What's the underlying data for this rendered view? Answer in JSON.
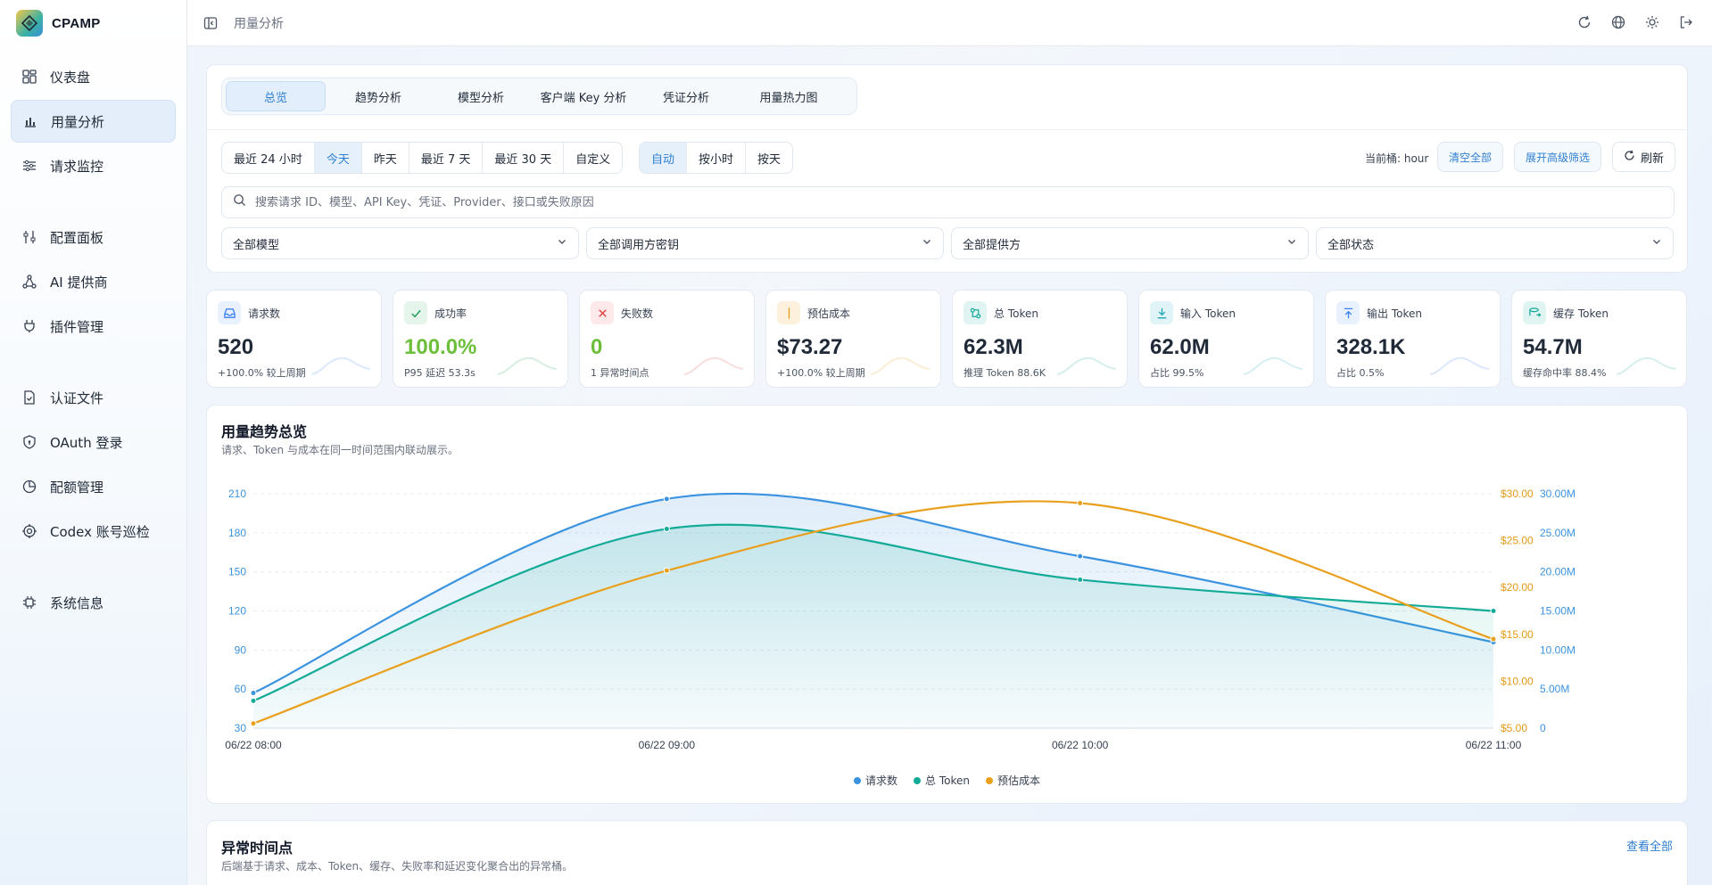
{
  "app": {
    "name": "CPAMP"
  },
  "sidebar": {
    "items": [
      {
        "label": "仪表盘",
        "icon": "dashboard-icon"
      },
      {
        "label": "用量分析",
        "icon": "bar-chart-icon",
        "active": true
      },
      {
        "label": "请求监控",
        "icon": "sliders-icon"
      },
      {
        "label": "配置面板",
        "icon": "settings-sliders-icon"
      },
      {
        "label": "AI 提供商",
        "icon": "nodes-icon"
      },
      {
        "label": "插件管理",
        "icon": "plug-icon"
      },
      {
        "label": "认证文件",
        "icon": "file-check-icon"
      },
      {
        "label": "OAuth 登录",
        "icon": "shield-icon"
      },
      {
        "label": "配额管理",
        "icon": "pie-icon"
      },
      {
        "label": "Codex 账号巡检",
        "icon": "target-icon"
      },
      {
        "label": "系统信息",
        "icon": "chip-icon"
      }
    ]
  },
  "topbar": {
    "breadcrumb": "用量分析"
  },
  "tabs": [
    "总览",
    "趋势分析",
    "模型分析",
    "客户端 Key 分析",
    "凭证分析",
    "用量热力图"
  ],
  "range_options": [
    "最近 24 小时",
    "今天",
    "昨天",
    "最近 7 天",
    "最近 30 天",
    "自定义"
  ],
  "range_active": "今天",
  "granularity_options": [
    "自动",
    "按小时",
    "按天"
  ],
  "granularity_active": "自动",
  "bucket_label": "当前桶: hour",
  "buttons": {
    "clear_all": "清空全部",
    "advanced": "展开高级筛选",
    "refresh": "刷新",
    "view_all": "查看全部"
  },
  "search": {
    "placeholder": "搜索请求 ID、模型、API Key、凭证、Provider、接口或失败原因"
  },
  "filters": [
    "全部模型",
    "全部调用方密钥",
    "全部提供方",
    "全部状态"
  ],
  "stats": [
    {
      "label": "请求数",
      "value": "520",
      "sub": "+100.0% 较上周期",
      "icon": "inbox-icon",
      "color": "#3b82f6",
      "bg": "#e8f1fd",
      "value_color": "#1f2937"
    },
    {
      "label": "成功率",
      "value": "100.0%",
      "sub": "P95 延迟 53.3s",
      "icon": "check-icon",
      "color": "#22a05a",
      "bg": "#e6f5ec",
      "value_color": "#6cbf3a"
    },
    {
      "label": "失败数",
      "value": "0",
      "sub": "1 异常时间点",
      "icon": "x-icon",
      "color": "#e04646",
      "bg": "#fde9e9",
      "value_color": "#6cbf3a"
    },
    {
      "label": "预估成本",
      "value": "$73.27",
      "sub": "+100.0% 较上周期",
      "icon": "dollar-icon",
      "color": "#e39a17",
      "bg": "#fdf1dd",
      "value_color": "#1f2937"
    },
    {
      "label": "总 Token",
      "value": "62.3M",
      "sub": "推理 Token 88.6K",
      "icon": "token-icon",
      "color": "#14a89a",
      "bg": "#e0f5f2",
      "value_color": "#1f2937"
    },
    {
      "label": "输入 Token",
      "value": "62.0M",
      "sub": "占比 99.5%",
      "icon": "download-icon",
      "color": "#1fa8b8",
      "bg": "#e0f3f6",
      "value_color": "#1f2937"
    },
    {
      "label": "输出 Token",
      "value": "328.1K",
      "sub": "占比 0.5%",
      "icon": "upload-icon",
      "color": "#3b82f6",
      "bg": "#e8f1fd",
      "value_color": "#1f2937"
    },
    {
      "label": "缓存 Token",
      "value": "54.7M",
      "sub": "缓存命中率 88.4%",
      "icon": "cache-icon",
      "color": "#14a89a",
      "bg": "#e0f5f2",
      "value_color": "#1f2937"
    }
  ],
  "chart": {
    "title": "用量趋势总览",
    "subtitle": "请求、Token 与成本在同一时间范围内联动展示。"
  },
  "chart_data": {
    "type": "line",
    "x": [
      "06/22 08:00",
      "06/22 09:00",
      "06/22 10:00",
      "06/22 11:00"
    ],
    "series": [
      {
        "name": "请求数",
        "values": [
          57,
          206,
          162,
          96
        ],
        "color": "#3b93e0",
        "axis": "left"
      },
      {
        "name": "总 Token",
        "values": [
          3.5,
          25.5,
          19.0,
          15.0
        ],
        "unit": "M",
        "color": "#13ab97",
        "axis": "right2"
      },
      {
        "name": "预估成本",
        "values": [
          5.5,
          21.8,
          29.0,
          14.5
        ],
        "unit": "$",
        "color": "#e9a01e",
        "axis": "right1"
      }
    ],
    "left_axis": {
      "ticks": [
        "210",
        "180",
        "150",
        "120",
        "90",
        "60",
        "30"
      ],
      "range": [
        30,
        210
      ],
      "color": "#3b93e0"
    },
    "right1_axis": {
      "ticks": [
        "$30.00",
        "$25.00",
        "$20.00",
        "$15.00",
        "$10.00",
        "$5.00"
      ],
      "range": [
        5,
        30
      ],
      "color": "#e39a17"
    },
    "right2_axis": {
      "ticks": [
        "30.00M",
        "25.00M",
        "20.00M",
        "15.00M",
        "10.00M",
        "5.00M",
        "0"
      ],
      "range": [
        0,
        30
      ],
      "color": "#3b93e0"
    },
    "grid": true,
    "legend": "bottom-center"
  },
  "anomaly": {
    "title": "异常时间点",
    "subtitle": "后端基于请求、成本、Token、缓存、失败率和延迟变化聚合出的异常桶。"
  }
}
